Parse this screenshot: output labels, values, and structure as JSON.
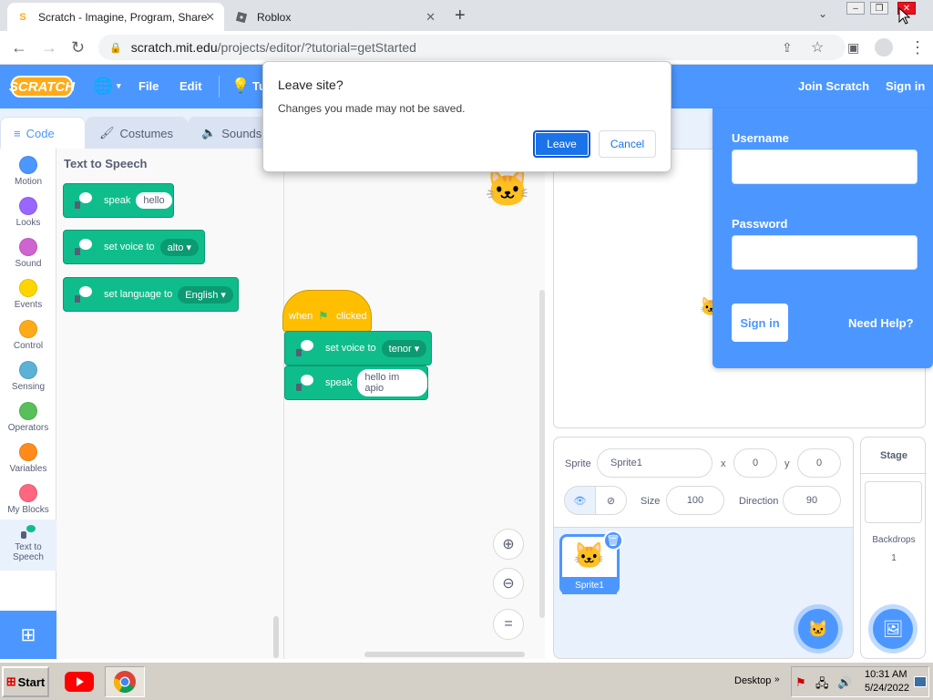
{
  "browser": {
    "tabs": [
      {
        "title": "Scratch - Imagine, Program, Share",
        "active": true
      },
      {
        "title": "Roblox",
        "active": false
      }
    ],
    "url_host": "scratch.mit.edu",
    "url_path": "/projects/editor/?tutorial=getStarted"
  },
  "menubar": {
    "logo": "SCRATCH",
    "file": "File",
    "edit": "Edit",
    "tutorials_partial": "Tu",
    "join": "Join Scratch",
    "signin": "Sign in"
  },
  "editor_tabs": {
    "code": "Code",
    "costumes": "Costumes",
    "sounds": "Sounds"
  },
  "categories": [
    {
      "label": "Motion",
      "color": "#4c97ff"
    },
    {
      "label": "Looks",
      "color": "#9966ff"
    },
    {
      "label": "Sound",
      "color": "#cf63cf"
    },
    {
      "label": "Events",
      "color": "#ffd500"
    },
    {
      "label": "Control",
      "color": "#ffab19"
    },
    {
      "label": "Sensing",
      "color": "#5cb1d6"
    },
    {
      "label": "Operators",
      "color": "#59c059"
    },
    {
      "label": "Variables",
      "color": "#ff8c1a"
    },
    {
      "label": "My Blocks",
      "color": "#ff6680"
    },
    {
      "label": "Text to Speech",
      "color": "#0fbd8c"
    }
  ],
  "palette": {
    "title": "Text to Speech",
    "blocks": [
      {
        "text": "speak",
        "arg": "hello"
      },
      {
        "text": "set voice to",
        "arg": "alto"
      },
      {
        "text": "set language to",
        "arg": "English"
      }
    ]
  },
  "script": {
    "hat_when": "when",
    "hat_clicked": "clicked",
    "voice_text": "set voice to",
    "voice_arg": "tenor",
    "speak_text": "speak",
    "speak_arg": "hello im apio"
  },
  "dialog": {
    "title": "Leave site?",
    "message": "Changes you made may not be saved.",
    "leave": "Leave",
    "cancel": "Cancel"
  },
  "login": {
    "username_label": "Username",
    "password_label": "Password",
    "signin_button": "Sign in",
    "help": "Need Help?"
  },
  "sprite": {
    "sprite_label": "Sprite",
    "name": "Sprite1",
    "x_label": "x",
    "x": "0",
    "y_label": "y",
    "y": "0",
    "size_label": "Size",
    "size": "100",
    "direction_label": "Direction",
    "direction": "90",
    "thumb_name": "Sprite1"
  },
  "stage_pane": {
    "title": "Stage",
    "backdrops_label": "Backdrops",
    "backdrops_count": "1"
  },
  "taskbar": {
    "start": "Start",
    "desktop": "Desktop",
    "time": "10:31 AM",
    "date": "5/24/2022"
  },
  "colors": {
    "scratch_blue": "#4c97ff",
    "tts_green": "#0fbd8c",
    "events_yellow": "#ffbf00"
  }
}
